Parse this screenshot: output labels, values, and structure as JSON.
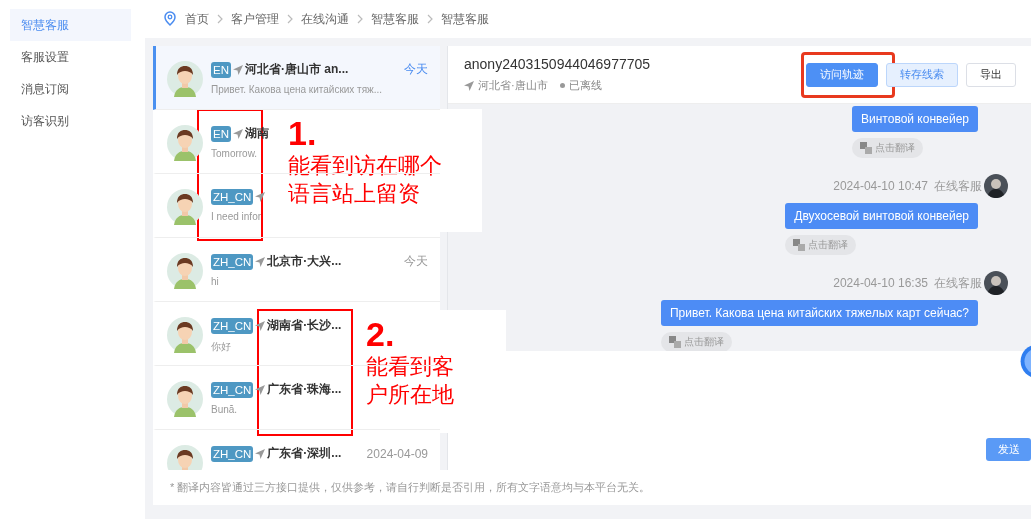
{
  "sidebar": {
    "items": [
      {
        "label": "智慧客服",
        "selected": true
      },
      {
        "label": "客服设置",
        "selected": false
      },
      {
        "label": "消息订阅",
        "selected": false
      },
      {
        "label": "访客识别",
        "selected": false
      }
    ]
  },
  "breadcrumb": [
    "首页",
    "客户管理",
    "在线沟通",
    "智慧客服",
    "智慧客服"
  ],
  "conversations": [
    {
      "lang": "EN",
      "location": "河北省·唐山市 an...",
      "time": "今天",
      "preview": "Привет. Какова цена китайских тяж...",
      "selected": true
    },
    {
      "lang": "EN",
      "location": "湖南",
      "preview": "Tomorrow.",
      "selected": false
    },
    {
      "lang": "ZH_CN",
      "preview": "I need infor",
      "selected": false
    },
    {
      "lang": "ZH_CN",
      "location": "北京市·大兴...",
      "time": "今天",
      "preview": "hi",
      "selected": false
    },
    {
      "lang": "ZH_CN",
      "location": "湖南省·长沙...",
      "preview": "你好",
      "selected": false
    },
    {
      "lang": "ZH_CN",
      "location": "广东省·珠海...",
      "preview": "Bună.",
      "selected": false
    },
    {
      "lang": "ZH_CN",
      "location": "广东省·深圳...",
      "time": "2024-04-09",
      "selected": false
    }
  ],
  "chat": {
    "visitor": "anony2403150944046977705",
    "location": "河北省·唐山市",
    "status": "已离线",
    "online": false,
    "buttons": [
      {
        "label": "访问轨迹",
        "kind": "primary"
      },
      {
        "label": "转存线索",
        "kind": "secondary"
      },
      {
        "label": "导出",
        "kind": "plain"
      }
    ],
    "messages": [
      {
        "text": "Винтовой конвейер",
        "translate": "点击翻译"
      },
      {
        "time": "2024-04-10 10:47",
        "sender": "在线客服",
        "text": "Двухосевой винтовой конвейер",
        "translate": "点击翻译"
      },
      {
        "time": "2024-04-10 16:35",
        "sender": "在线客服",
        "text": "Привет. Какова цена китайских тяжелых карт сейчас?",
        "translate": "点击翻译"
      }
    ],
    "send_button": "发送"
  },
  "footer_note": "* 翻译内容皆通过三方接口提供，仅供参考，请自行判断是否引用，所有文字语意均与本平台无关。",
  "annotations": [
    {
      "number": "1.",
      "text": "能看到访在哪个语言站上留资"
    },
    {
      "number": "2.",
      "text": "能看到客户所在地"
    }
  ]
}
